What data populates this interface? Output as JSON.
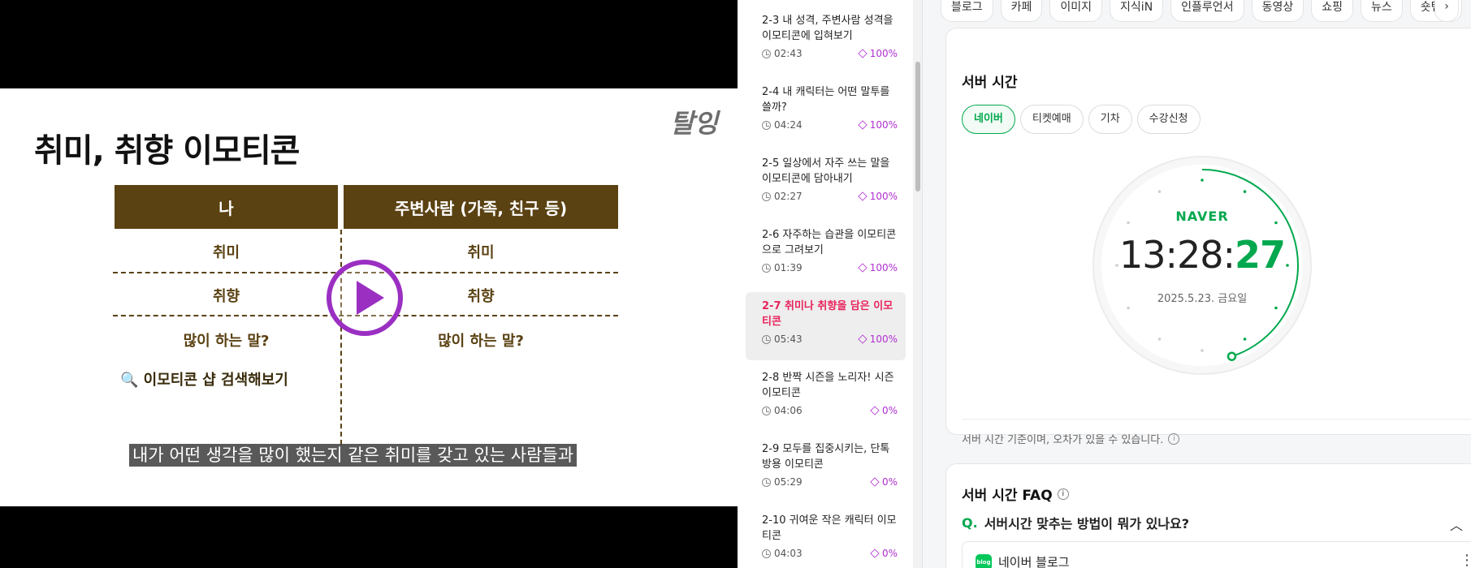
{
  "video": {
    "slide_title": "취미, 취향 이모티콘",
    "logo": "탈잉",
    "table_header_left": "나",
    "table_header_right": "주변사람 (가족, 친구 등)",
    "rows": [
      {
        "left": "취미",
        "right": "취미"
      },
      {
        "left": "취향",
        "right": "취향"
      },
      {
        "left": "많이 하는 말?",
        "right": "많이 하는 말?"
      }
    ],
    "search_hint": "🔍 이모티콘 샵 검색해보기",
    "subtitle": "내가 어떤 생각을 많이 했는지 같은 취미를 갖고 있는 사람들과",
    "play_icon": "play-icon"
  },
  "lessons": [
    {
      "title": "2-3 내 성격, 주변사람 성격을 이모티콘에 입혀보기",
      "duration": "02:43",
      "progress": "100%",
      "active": false
    },
    {
      "title": "2-4 내 캐릭터는 어떤 말투를 쓸까?",
      "duration": "04:24",
      "progress": "100%",
      "active": false
    },
    {
      "title": "2-5 일상에서 자주 쓰는 말을 이모티콘에 담아내기",
      "duration": "02:27",
      "progress": "100%",
      "active": false
    },
    {
      "title": "2-6 자주하는 습관을 이모티콘으로 그려보기",
      "duration": "01:39",
      "progress": "100%",
      "active": false
    },
    {
      "title": "2-7 취미나 취향을 담은 이모티콘",
      "duration": "05:43",
      "progress": "100%",
      "active": true
    },
    {
      "title": "2-8 반짝 시즌을 노리자! 시즌 이모티콘",
      "duration": "04:06",
      "progress": "0%",
      "active": false
    },
    {
      "title": "2-9 모두를 집중시키는, 단톡방용 이모티콘",
      "duration": "05:29",
      "progress": "0%",
      "active": false
    },
    {
      "title": "2-10 귀여운 작은 캐릭터 이모티콘",
      "duration": "04:03",
      "progress": "0%",
      "active": false
    }
  ],
  "naver": {
    "tabs": [
      "블로그",
      "카페",
      "이미지",
      "지식iN",
      "인플루언서",
      "동영상",
      "쇼핑",
      "뉴스",
      "숏텐츠"
    ],
    "tab_next": "›",
    "server_time": {
      "title": "서버 시간",
      "pills": [
        "네이버",
        "티켓예매",
        "기차",
        "수강신청"
      ],
      "selected_pill": "네이버",
      "brand": "NAVER",
      "time_hm": "13:28:",
      "time_sec": "27",
      "date": "2025.5.23. 금요일",
      "note": "서버 시간 기준이며, 오차가 있을 수 있습니다.",
      "accent_color": "#03a84e"
    },
    "faq": {
      "title": "서버 시간 FAQ",
      "question_mark": "Q.",
      "question": "서버시간 맞추는 방법이 뭐가 있나요?",
      "blog_label": "네이버 블로그",
      "blog_icon_text": "blog"
    }
  }
}
